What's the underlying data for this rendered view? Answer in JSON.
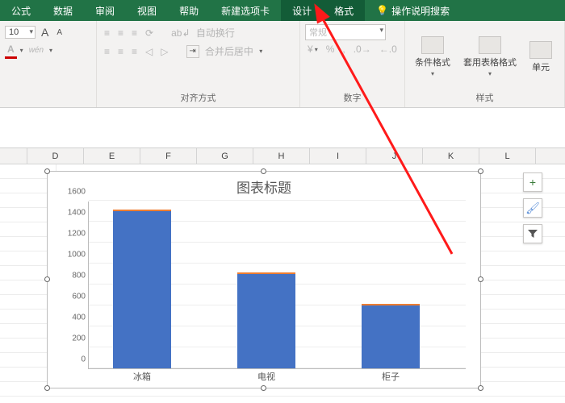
{
  "tabs": {
    "formula": "公式",
    "data": "数据",
    "review": "审阅",
    "view": "视图",
    "help": "帮助",
    "newtab": "新建选项卡",
    "design": "设计",
    "format": "格式",
    "tellme": "操作说明搜索"
  },
  "ribbon": {
    "font_size": "10",
    "increase_font": "A",
    "decrease_font": "A",
    "font_color": "A",
    "phonetic": "wén",
    "align_group": "对齐方式",
    "number_group": "数字",
    "styles_group": "样式",
    "wrap": "自动换行",
    "merge": "合并后居中",
    "number_format": "常规",
    "percent": "%",
    "thousands": ",",
    "inc_dec": ".0",
    "cond_format": "条件格式",
    "table_format": "套用表格格式",
    "cell_styles": "单元"
  },
  "columns": [
    "D",
    "E",
    "F",
    "G",
    "H",
    "I",
    "J",
    "K",
    "L"
  ],
  "chart_data": {
    "type": "bar",
    "title": "图表标题",
    "categories": [
      "冰箱",
      "电视",
      "柜子"
    ],
    "values": [
      1500,
      900,
      600
    ],
    "ylim": [
      0,
      1600
    ],
    "ystep": 200,
    "xlabel": "",
    "ylabel": ""
  },
  "side": {
    "plus": "+",
    "brush": "🖌",
    "funnel": "▾"
  },
  "colors": {
    "accent": "#217346",
    "bar": "#4472C4"
  }
}
